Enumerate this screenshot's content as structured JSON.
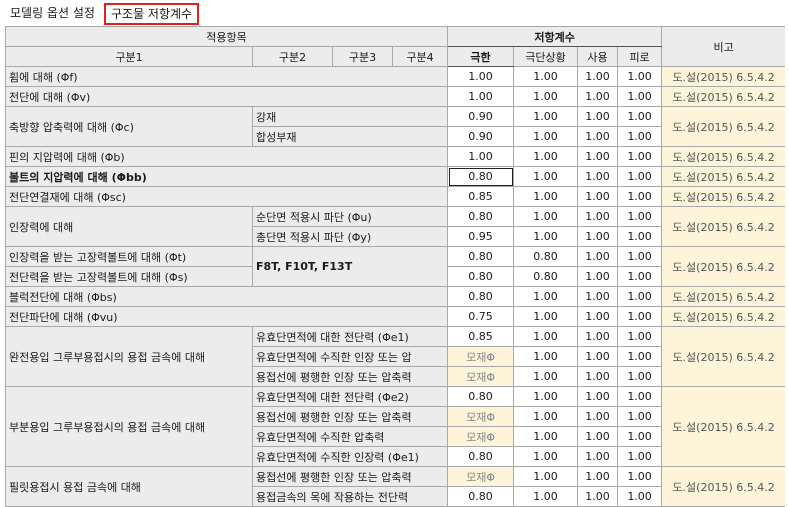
{
  "tabs": {
    "modeling": "모델링 옵션 설정",
    "resistance": "구조물 저항계수"
  },
  "headers": {
    "apply": "적용항목",
    "resistance": "저항계수",
    "note": "비고",
    "cat1": "구분1",
    "cat2": "구분2",
    "cat3": "구분3",
    "cat4": "구분4",
    "ult": "극한",
    "ext": "극단상황",
    "svc": "사용",
    "fat": "피로"
  },
  "note_text": "도.설(2015) 6.5.4.2",
  "rows": {
    "r1": {
      "label": "휨에 대해 (Φf)",
      "ult": "1.00",
      "ext": "1.00",
      "svc": "1.00",
      "fat": "1.00"
    },
    "r2": {
      "label": "전단에 대해 (Φv)",
      "ult": "1.00",
      "ext": "1.00",
      "svc": "1.00",
      "fat": "1.00"
    },
    "r3": {
      "label": "축방향 압축력에 대해 (Φc)",
      "sub1": "강재",
      "sub2": "합성부재",
      "ult1": "0.90",
      "ult2": "0.90",
      "ext": "1.00",
      "svc": "1.00",
      "fat": "1.00"
    },
    "r4": {
      "label": "핀의 지압력에 대해 (Φb)",
      "ult": "1.00",
      "ext": "1.00",
      "svc": "1.00",
      "fat": "1.00"
    },
    "r5": {
      "label": "볼트의 지압력에 대해 (Φbb)",
      "ult": "0.80",
      "ext": "1.00",
      "svc": "1.00",
      "fat": "1.00"
    },
    "r6": {
      "label": "전단연결재에 대해 (Φsc)",
      "ult": "0.85",
      "ext": "1.00",
      "svc": "1.00",
      "fat": "1.00"
    },
    "r7": {
      "label": "인장력에 대해",
      "sub1": "순단면 적용시 파단 (Φu)",
      "sub2": "총단면 적용시 파단 (Φy)",
      "ult1": "0.80",
      "ult2": "0.95",
      "ext": "1.00",
      "svc": "1.00",
      "fat": "1.00"
    },
    "r8": {
      "label1": "인장력을 받는 고장력볼트에 대해 (Φt)",
      "label2": "전단력을 받는 고장력볼트에 대해 (Φs)",
      "bolts": "F8T, F10T, F13T",
      "ult1": "0.80",
      "ult2": "0.80",
      "ext": "0.80",
      "svc": "1.00",
      "fat": "1.00"
    },
    "r9": {
      "label": "블럭전단에 대해 (Φbs)",
      "ult": "0.80",
      "ext": "1.00",
      "svc": "1.00",
      "fat": "1.00"
    },
    "r10": {
      "label": "전단파단에 대해 (Φvu)",
      "ult": "0.75",
      "ext": "1.00",
      "svc": "1.00",
      "fat": "1.00"
    },
    "r11": {
      "label": "완전용입 그루부용접시의 용접 금속에 대해",
      "sub1": "유효단면적에 대한 전단력 (Φe1)",
      "sub2": "유효단면적에 수직한 인장 또는 압",
      "sub3": "용접선에 평행한 인장 또는 압축력",
      "ult1": "0.85",
      "base": "모재Φ",
      "ext": "1.00",
      "svc": "1.00",
      "fat": "1.00"
    },
    "r12": {
      "label": "부분용입 그루부용접시의 용접 금속에 대해",
      "sub1": "유효단면적에 대한 전단력 (Φe2)",
      "sub2": "용접선에 평행한 인장 또는 압축력",
      "sub3": "유효단면적에 수직한 압축력",
      "sub4": "유효단면적에 수직한 인장력 (Φe1)",
      "ult1": "0.80",
      "base": "모재Φ",
      "ult4": "0.80",
      "ext": "1.00",
      "svc": "1.00",
      "fat": "1.00"
    },
    "r13": {
      "label": "필릿용접시 용접 금속에 대해",
      "sub1": "용접선에 평행한 인장 또는 압축력",
      "sub2": "용접금속의 목에 작용하는 전단력",
      "base": "모재Φ",
      "ult2": "0.80",
      "ext": "1.00",
      "svc": "1.00",
      "fat": "1.00"
    }
  }
}
